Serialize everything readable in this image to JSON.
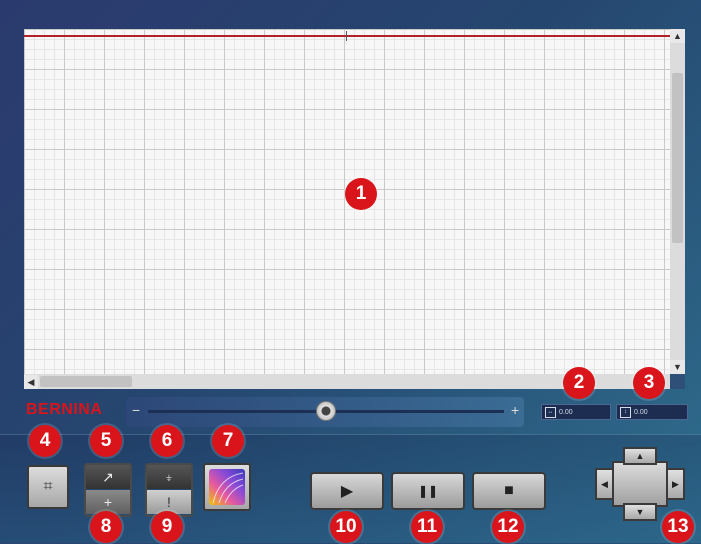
{
  "brand": "BERNINA",
  "zoom": {
    "minus_label": "−",
    "plus_label": "+",
    "level": 0.5
  },
  "coordinates": {
    "width_icon": "arrows-horizontal-icon",
    "width_value": "0.00",
    "height_icon": "arrows-vertical-icon",
    "height_value": "0.00"
  },
  "callouts": [
    "1",
    "2",
    "3",
    "4",
    "5",
    "6",
    "7",
    "8",
    "9",
    "10",
    "11",
    "12",
    "13"
  ],
  "toolbar": {
    "crop": "crop-icon",
    "needle_up": "needle-up-icon",
    "needle_down": "needle-down-icon",
    "thread_up": "thread-up-icon",
    "thread_down": "thread-down-icon",
    "color": "color-palette-icon",
    "play": "▶",
    "pause": "❚❚",
    "stop": "■"
  },
  "dpad": {
    "up": "▲",
    "down": "▼",
    "left": "◀",
    "right": "▶"
  },
  "colors": {
    "accent": "#d9151b",
    "guideline": "#b0232a"
  }
}
